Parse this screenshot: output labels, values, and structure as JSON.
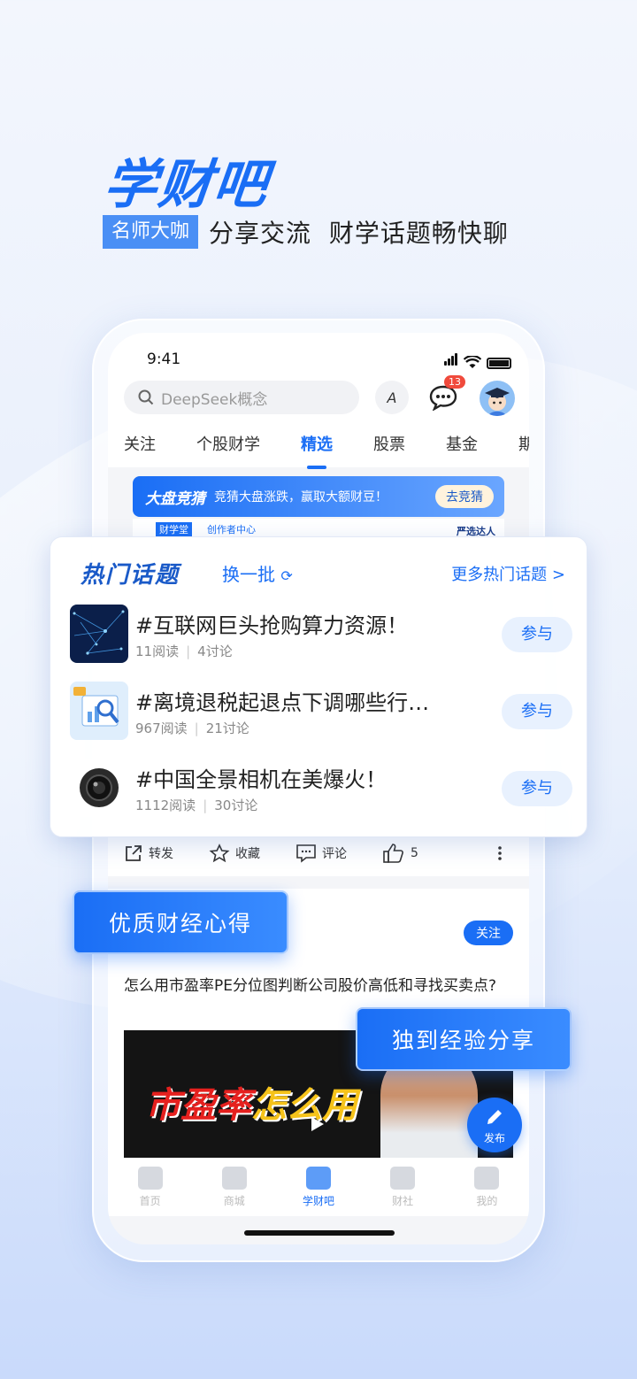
{
  "promo": {
    "headline": "学财吧",
    "tag": "名师大咖",
    "subtext": "分享交流  财学话题畅快聊"
  },
  "status": {
    "time": "9:41"
  },
  "topbar": {
    "search_placeholder": "DeepSeek概念",
    "font_button": "A",
    "messages_badge": "13"
  },
  "tabs": [
    "关注",
    "个股财学",
    "精选",
    "股票",
    "基金",
    "期"
  ],
  "active_tab": "精选",
  "banner": {
    "title": "大盘竞猜",
    "subtitle": "竞猜大盘涨跌，赢取大额财豆！",
    "button": "去竞猜"
  },
  "strip": {
    "left": "财学堂",
    "center": "创作者中心",
    "right": "严选达人"
  },
  "hot_topics": {
    "title": "热门话题",
    "refresh_label": "换一批",
    "more_label": "更多热门话题 >",
    "items": [
      {
        "title": "#互联网巨头抢购算力资源！",
        "reads": "11阅读",
        "comments": "4讨论",
        "join": "参与",
        "thumb": "network-thumb"
      },
      {
        "title": "#离境退税起退点下调哪些行…",
        "reads": "967阅读",
        "comments": "21讨论",
        "join": "参与",
        "thumb": "chart-thumb"
      },
      {
        "title": "#中国全景相机在美爆火！",
        "reads": "1112阅读",
        "comments": "30讨论",
        "join": "参与",
        "thumb": "camera-thumb"
      }
    ]
  },
  "actions": {
    "share": "转发",
    "favorite": "收藏",
    "comment": "评论",
    "like_count": "5"
  },
  "post": {
    "follow": "关注",
    "title": "怎么用市盈率PE分位图判断公司股价高低和寻找买卖点?",
    "video_text_a": "市盈率",
    "video_text_b": "怎么用"
  },
  "fab_label": "发布",
  "pills": {
    "left": "优质财经心得",
    "right": "独到经验分享"
  },
  "nav": [
    {
      "label": "首页",
      "icon": "chart-icon"
    },
    {
      "label": "商城",
      "icon": "bag-icon"
    },
    {
      "label": "学财吧",
      "icon": "graduation-cap-icon"
    },
    {
      "label": "财社",
      "icon": "chat-icon"
    },
    {
      "label": "我的",
      "icon": "user-icon"
    }
  ],
  "colors": {
    "accent": "#1a6ef5",
    "badge": "#f04a3c"
  }
}
